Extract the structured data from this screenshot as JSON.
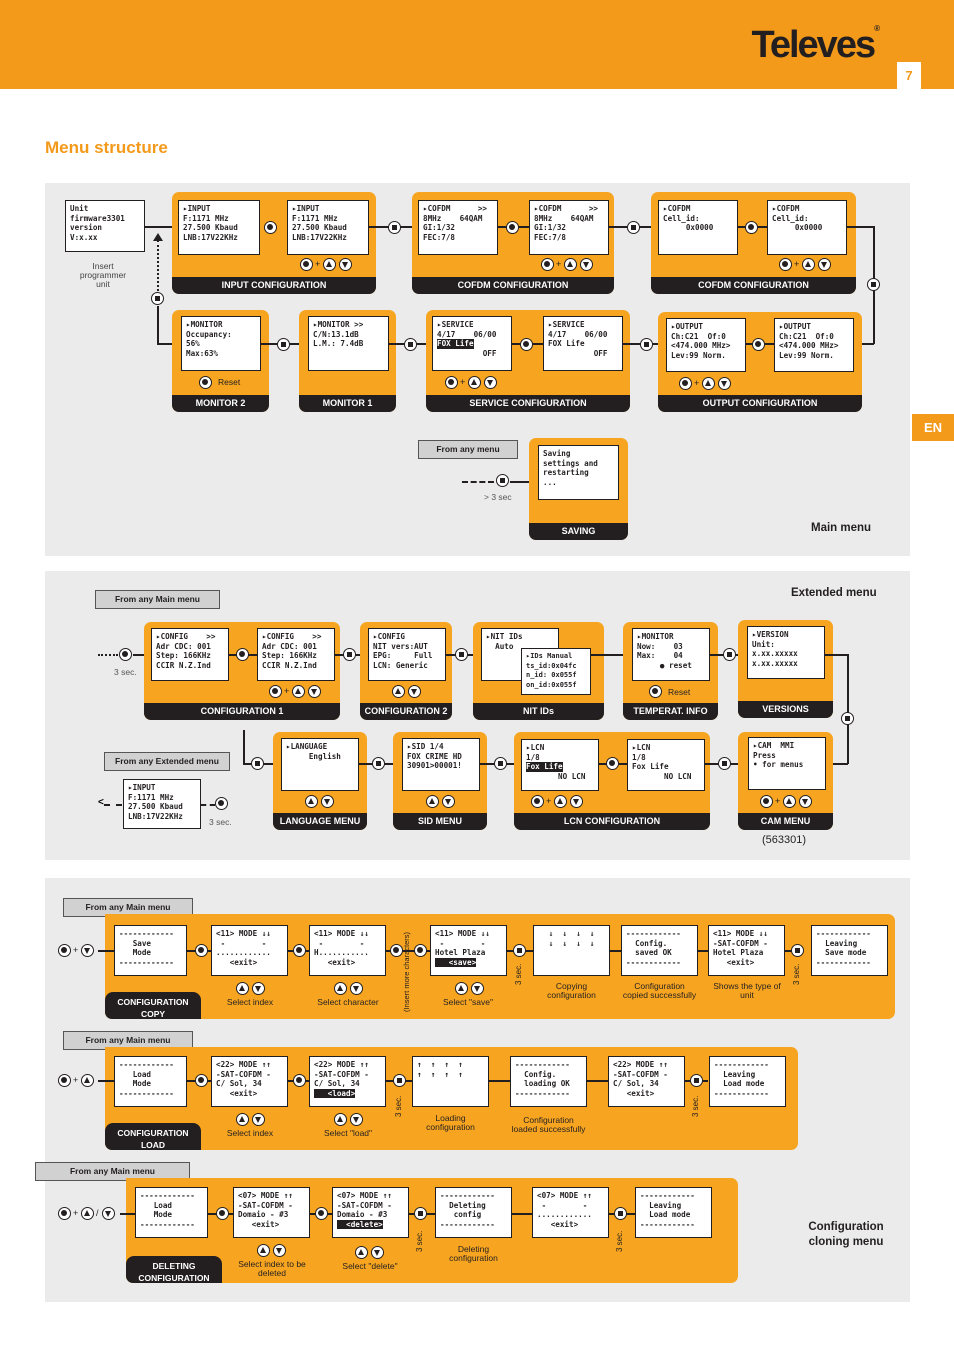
{
  "header": {
    "brand": "Televes",
    "page_number": "7",
    "language_tab": "EN"
  },
  "page_title": "Menu structure",
  "main_menu": {
    "title": "Main menu",
    "unit_screen": [
      "Unit",
      "firmware3301",
      "version",
      "V:x.xx"
    ],
    "unit_caption": [
      "Insert",
      "programmer",
      "unit"
    ],
    "groups": [
      {
        "label": "INPUT CONFIGURATION",
        "screens": [
          [
            "▸INPUT",
            "F:1171 MHz",
            "27.500 Kbaud",
            "LNB:17V22KHz"
          ],
          [
            "▸INPUT",
            "F:1171 MHz",
            "27.500 Kbaud",
            "LNB:17V22KHz"
          ]
        ]
      },
      {
        "label": "COFDM CONFIGURATION",
        "screens": [
          [
            "▸COFDM      >>",
            "8MHz    64QAM",
            "GI:1/32",
            "FEC:7/8"
          ],
          [
            "▸COFDM      >>",
            "8MHz    64QAM",
            "GI:1/32",
            "FEC:7/8"
          ]
        ]
      },
      {
        "label": "COFDM CONFIGURATION",
        "screens": [
          [
            "▸COFDM",
            "Cell_id:",
            "     0x0000"
          ],
          [
            "▸COFDM",
            "Cell_id:",
            "     0x0000"
          ]
        ]
      },
      {
        "label": "MONITOR 2",
        "screens": [
          [
            "▸MONITOR",
            "Occupancy:",
            "56%",
            "Max:63%"
          ]
        ],
        "button_label": "Reset"
      },
      {
        "label": "MONITOR 1",
        "screens": [
          [
            "▸MONITOR >>",
            "C/N:13.1dB",
            "",
            "L.M.: 7.4dB"
          ]
        ]
      },
      {
        "label": "SERVICE CONFIGURATION",
        "screens": [
          [
            "▸SERVICE",
            "4/17    06/00",
            "FOX Life",
            "          OFF"
          ],
          [
            "▸SERVICE",
            "4/17    06/00",
            "FOX Life",
            "          OFF"
          ]
        ]
      },
      {
        "label": "OUTPUT CONFIGURATION",
        "screens": [
          [
            "▸OUTPUT",
            "Ch:C21  Of:0",
            "<474.000 MHz>",
            "Lev:99 Norm."
          ],
          [
            "▸OUTPUT",
            "Ch:C21  Of:0",
            "<474.000 MHz>",
            "Lev:99 Norm."
          ]
        ]
      }
    ],
    "saving": {
      "callout": "From any menu",
      "hold": "> 3 sec",
      "screen": [
        "Saving",
        "settings and",
        "restarting",
        "..."
      ],
      "label": "SAVING"
    }
  },
  "extended_menu": {
    "title": "Extended menu",
    "callout_main": "From any Main menu",
    "callout_ext": "From any Extended menu",
    "hold": "3 sec.",
    "model": "(563301)",
    "groups": [
      {
        "label": "CONFIGURATION 1",
        "screens": [
          [
            "▸CONFIG    >>",
            "Adr CDC: 001",
            "Step: 166KHz",
            "CCIR N.Z.Ind"
          ],
          [
            "▸CONFIG    >>",
            "Adr CDC: 001",
            "Step: 166KHz",
            "CCIR N.Z.Ind"
          ]
        ]
      },
      {
        "label": "CONFIGURATION 2",
        "screens": [
          [
            "▸CONFIG",
            "NIT vers:AUT",
            "EPG:     Full",
            "LCN: Generic"
          ]
        ]
      },
      {
        "label": "NIT IDs",
        "screens": [
          [
            "▸NIT IDs",
            "  Auto"
          ],
          [
            "▸IDs Manual",
            "ts_id:0x04fc",
            "n_id: 0x055f",
            "on_id:0x055f"
          ]
        ]
      },
      {
        "label": "TEMPERAT. INFO",
        "screens": [
          [
            "▸MONITOR",
            "Now:    03",
            "Max:    04",
            "     ● reset"
          ]
        ],
        "button_label": "Reset"
      },
      {
        "label": "VERSIONS",
        "screens": [
          [
            "▸VERSION",
            "Unit:",
            "x.xx.xxxxx",
            "x.xx.xxxxx"
          ]
        ]
      },
      {
        "label": "LANGUAGE MENU",
        "screens": [
          [
            "▸LANGUAGE",
            "",
            "     English"
          ]
        ]
      },
      {
        "label": "SID MENU",
        "screens": [
          [
            "▸SID 1/4",
            "FOX CRIME HD",
            "",
            "30901>00001!"
          ]
        ]
      },
      {
        "label": "LCN CONFIGURATION",
        "screens": [
          [
            "▸LCN",
            "1/8",
            "Fox Life",
            "       NO LCN"
          ],
          [
            "▸LCN",
            "1/8",
            "Fox Life",
            "       NO LCN"
          ]
        ]
      },
      {
        "label": "CAM MENU",
        "screens": [
          [
            "▸CAM  MMI",
            "Press",
            "• for menus"
          ]
        ]
      }
    ],
    "return_screen": [
      "▸INPUT",
      "F:1171 MHz",
      "27.500 Kbaud",
      "LNB:17V22KHz"
    ]
  },
  "cloning_menu": {
    "title": "Configuration cloning menu",
    "callout": "From any Main menu",
    "hold": "3 sec.",
    "insert_more": "(Insert more characters)",
    "copy": {
      "label": [
        "CONFIGURATION",
        "COPY"
      ],
      "screens": [
        [
          "------------",
          "   Save",
          "   Mode",
          "------------"
        ],
        [
          "<11> MODE ↓↓",
          " -        -",
          "............",
          "   <exit>"
        ],
        [
          "<11> MODE ↓↓",
          " -        -",
          "H...........",
          "   <exit>"
        ],
        [
          "<11> MODE ↓↓",
          " -        -",
          "Hotel Plaza",
          "   <save>"
        ],
        [
          "↓  ↓  ↓  ↓",
          "",
          "↓  ↓  ↓  ↓"
        ],
        [
          "------------",
          "  Config.",
          "  saved OK",
          "------------"
        ],
        [
          "<11> MODE ↓↓",
          "-SAT-COFDM -",
          "Hotel Plaza",
          "   <exit>"
        ],
        [
          "------------",
          "  Leaving",
          "  Save mode",
          "------------"
        ]
      ],
      "captions": [
        "Select index",
        "Select character",
        "Select \"save\"",
        "Copying configuration",
        "Configuration copied successfully",
        "Shows the type of unit"
      ]
    },
    "load": {
      "label": [
        "CONFIGURATION",
        "LOAD"
      ],
      "screens": [
        [
          "------------",
          "   Load",
          "   Mode",
          "------------"
        ],
        [
          "<22> MODE ↑↑",
          "-SAT-COFDM -",
          "C/ Sol, 34",
          "   <exit>"
        ],
        [
          "<22> MODE ↑↑",
          "-SAT-COFDM -",
          "C/ Sol, 34",
          "   <load>"
        ],
        [
          "↑  ↑  ↑  ↑",
          "",
          "↑  ↑  ↑  ↑"
        ],
        [
          "------------",
          "  Config.",
          "  loading OK",
          "------------"
        ],
        [
          "<22> MODE ↑↑",
          "-SAT-COFDM -",
          "C/ Sol, 34",
          "   <exit>"
        ],
        [
          "------------",
          "  Leaving",
          "  Load mode",
          "------------"
        ]
      ],
      "captions": [
        "Select index",
        "Select \"load\"",
        "Loading configuration",
        "Configuration loaded successfully"
      ]
    },
    "delete": {
      "label": [
        "DELETING",
        "CONFIGURATION"
      ],
      "screens": [
        [
          "------------",
          "   Load",
          "   Mode",
          "------------"
        ],
        [
          "<07> MODE ↑↑",
          "-SAT-COFDM -",
          "Domaio - #3",
          "   <exit>"
        ],
        [
          "<07> MODE ↑↑",
          "-SAT-COFDM -",
          "Domaio - #3",
          "  <delete>"
        ],
        [
          "------------",
          "  Deleting",
          "   config",
          "------------"
        ],
        [
          "<07> MODE ↑↑",
          " -        -",
          "............",
          "   <exit>"
        ],
        [
          "------------",
          "  Leaving",
          "  Load mode",
          "------------"
        ]
      ],
      "captions": [
        "Select index to be deleted",
        "Select \"delete\"",
        "Deleting configuration"
      ]
    }
  }
}
